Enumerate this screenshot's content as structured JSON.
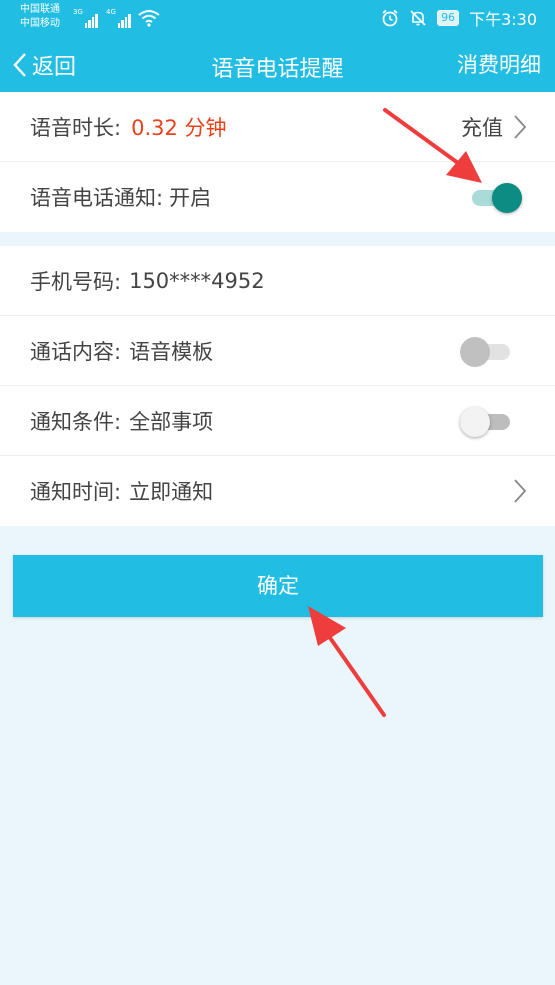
{
  "status_bar": {
    "carrier_1": "中国联通",
    "carrier_2": "中国移动",
    "network_1": "3G",
    "network_2": "4G",
    "battery": "96",
    "time": "下午3:30"
  },
  "nav": {
    "back_label": "返回",
    "title": "语音电话提醒",
    "right_label": "消费明细"
  },
  "balance": {
    "label": "语音时长:",
    "value": "0.32 分钟",
    "recharge_label": "充值"
  },
  "notify": {
    "label": "语音电话通知:",
    "state": "开启",
    "enabled": true
  },
  "settings": {
    "phone": {
      "label": "手机号码:",
      "value": "150****4952"
    },
    "content": {
      "label": "通话内容:",
      "value": "语音模板",
      "toggle": false
    },
    "condition": {
      "label": "通知条件:",
      "value": "全部事项",
      "toggle": false
    },
    "time": {
      "label": "通知时间:",
      "value": "立即通知"
    }
  },
  "confirm_label": "确定",
  "colors": {
    "brand": "#21bde3",
    "value_red": "#e8421d",
    "toggle_on": "#0c8c82",
    "arrow_red": "#ef3d3d",
    "background": "#eaf6fb"
  }
}
